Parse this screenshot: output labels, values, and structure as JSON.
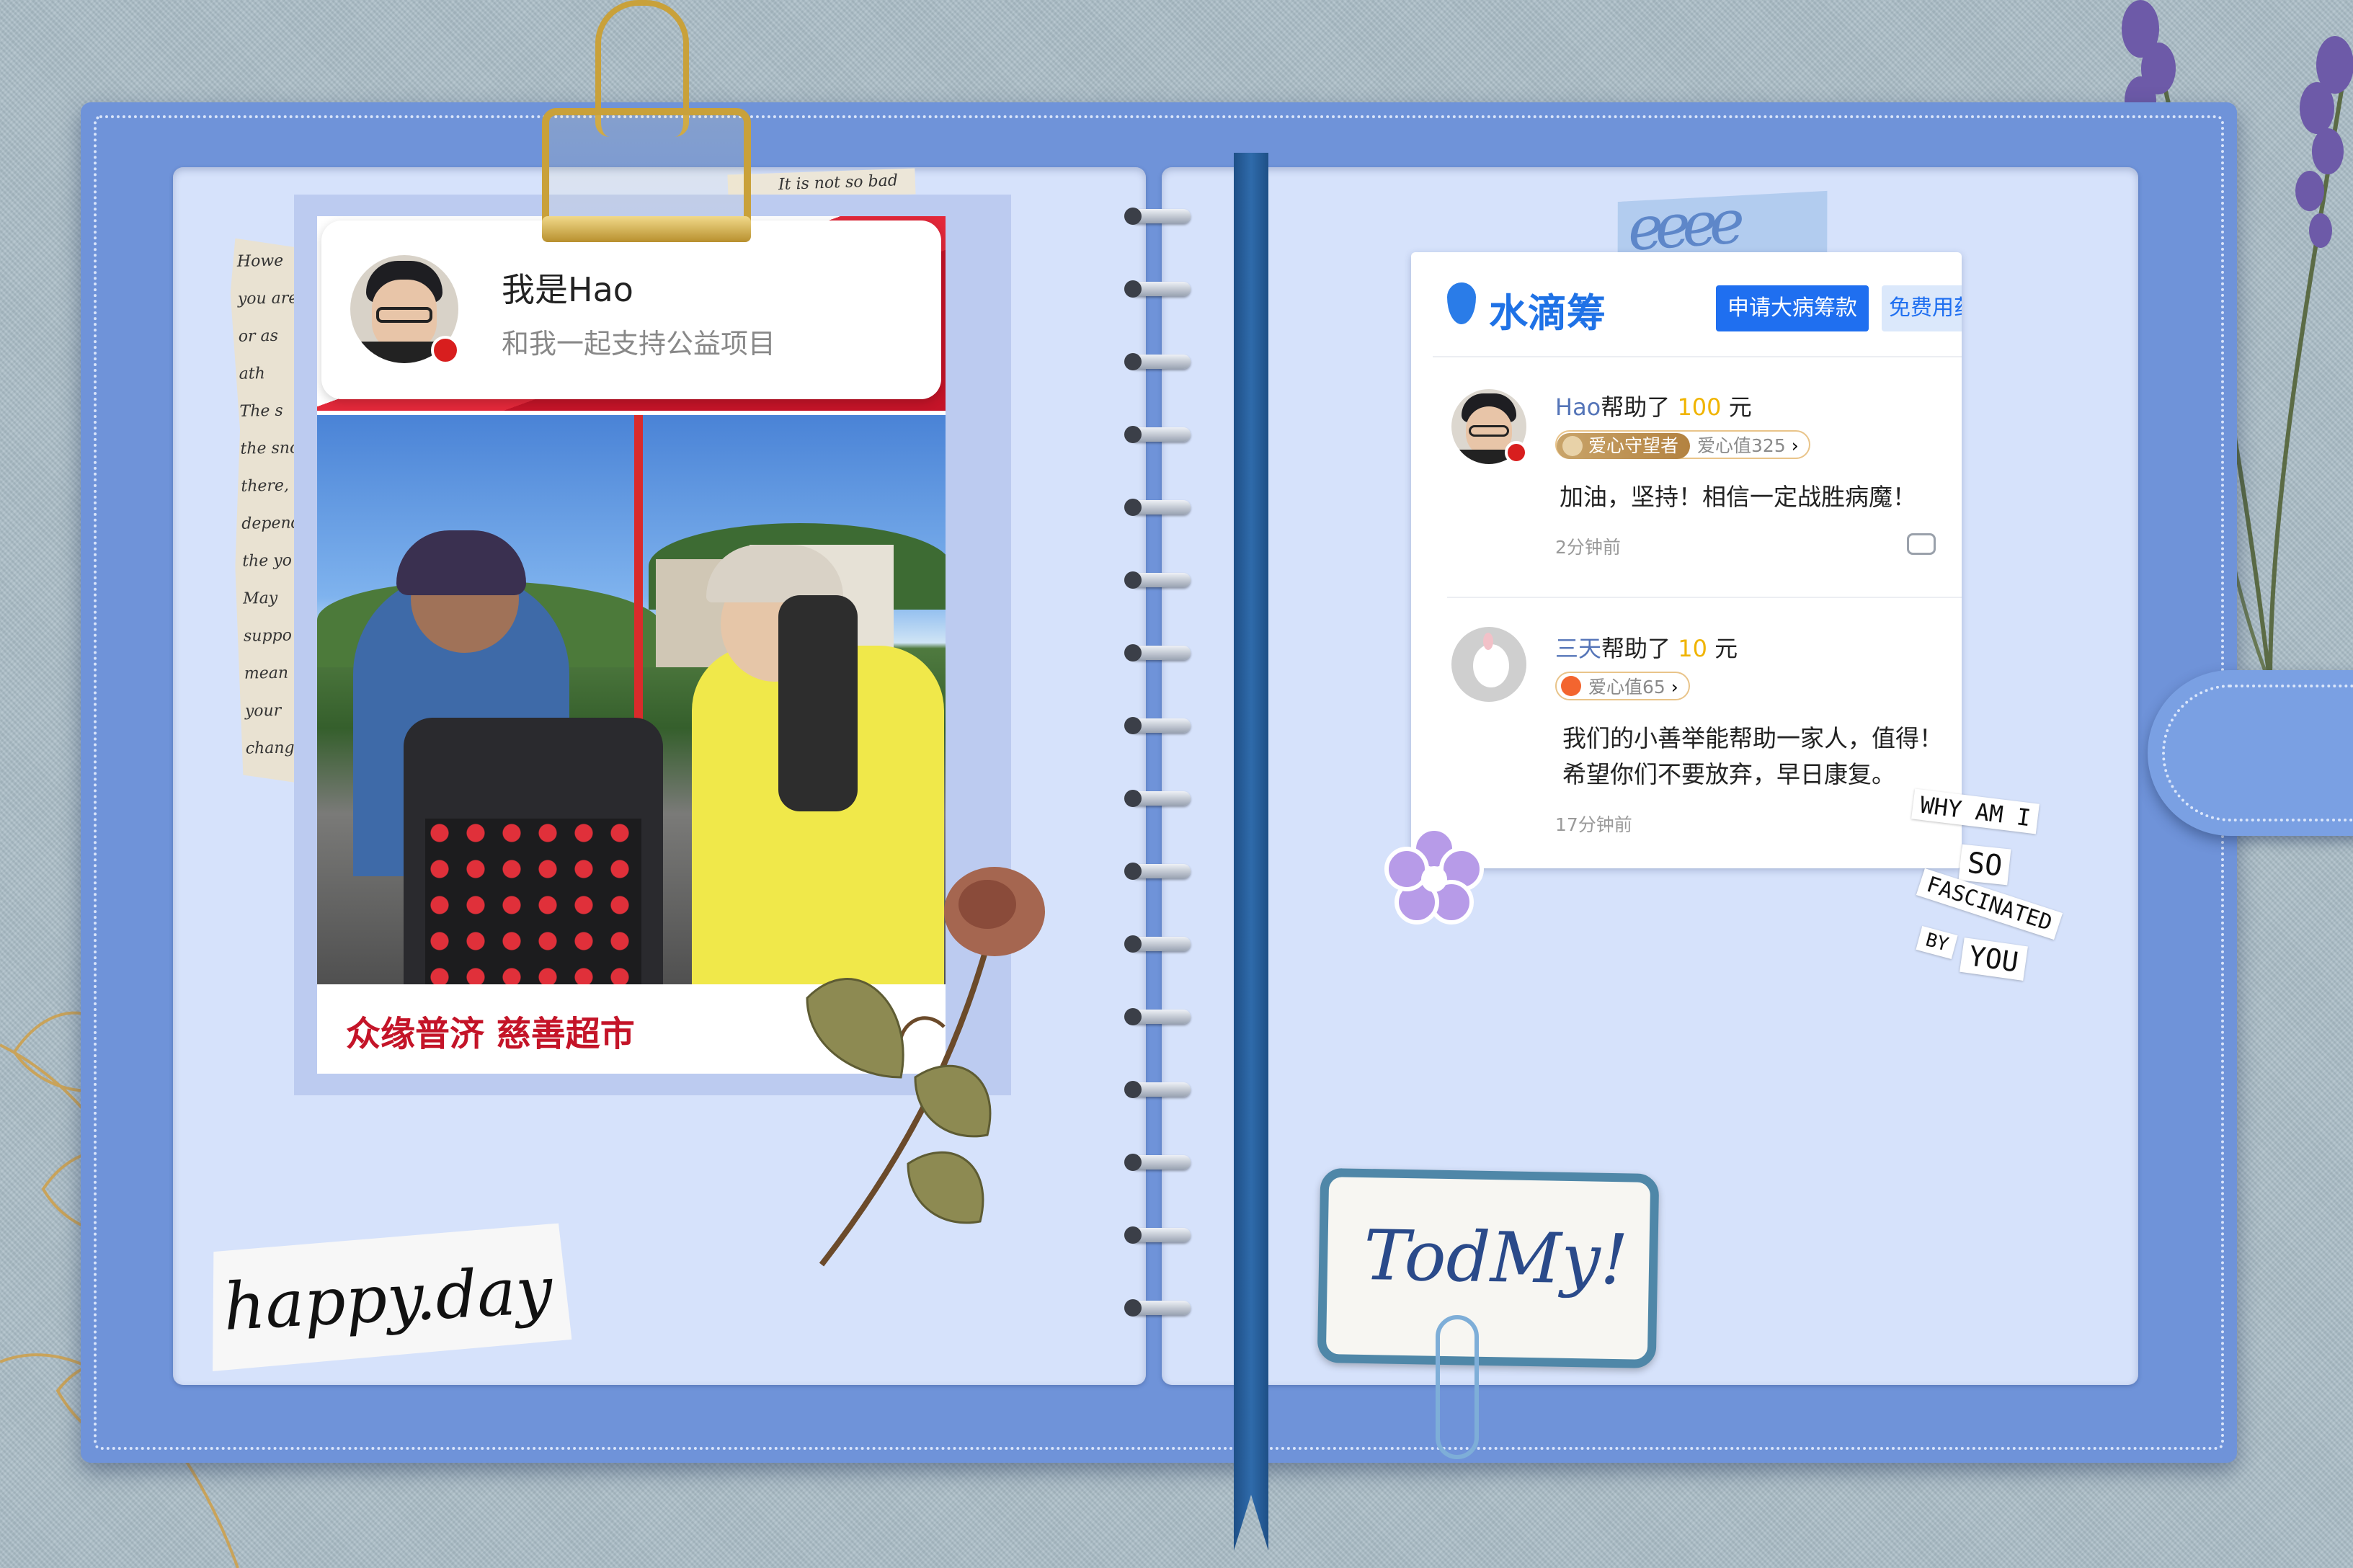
{
  "left_card": {
    "profile_name": "我是Hao",
    "profile_subtitle": "和我一起支持公益项目",
    "caption": "众缘普济 慈善超市"
  },
  "torn_paper": {
    "top_text": "It is not so bad",
    "lines": [
      "Howe",
      "you are",
      "or as",
      "ath",
      "The s",
      "the snow",
      "there, a",
      "depend",
      "the yo",
      "May",
      "suppo",
      "mean",
      "your",
      "chang"
    ]
  },
  "app_header": {
    "logo_text": "水滴筹",
    "apply_button": "申请大病筹款",
    "free_med_button": "免费用药"
  },
  "comments": [
    {
      "name": "Hao",
      "helped_label": "帮助了",
      "amount": "100",
      "unit": "元",
      "badge_title": "爱心守望者",
      "love_value": "爱心值325",
      "text": "加油，坚持！相信一定战胜病魔！",
      "time": "2分钟前"
    },
    {
      "name": "三天",
      "helped_label": "帮助了",
      "amount": "10",
      "unit": "元",
      "love_value": "爱心值65",
      "text": "我们的小善举能帮助一家人，值得！希望你们不要放弃，早日康复。",
      "time": "17分钟前"
    }
  ],
  "stickers": {
    "quote_lines": [
      "WHY AM I",
      "SO",
      "FASCINATED",
      "BY",
      "YOU"
    ],
    "today_text": "TodMy!",
    "happy_text": "happy.day",
    "washi_text": "eeee"
  },
  "colors": {
    "cover": "#6f93d9",
    "page": "#d6e2fb",
    "brand_blue": "#1f72e6",
    "charity_red": "#c41428",
    "amount_yellow": "#f0b400"
  },
  "icons": [
    "chevron-right-icon",
    "comment-icon",
    "thumbs-up-icon",
    "water-drop-logo-icon",
    "china-flag-icon",
    "heart-icon"
  ]
}
